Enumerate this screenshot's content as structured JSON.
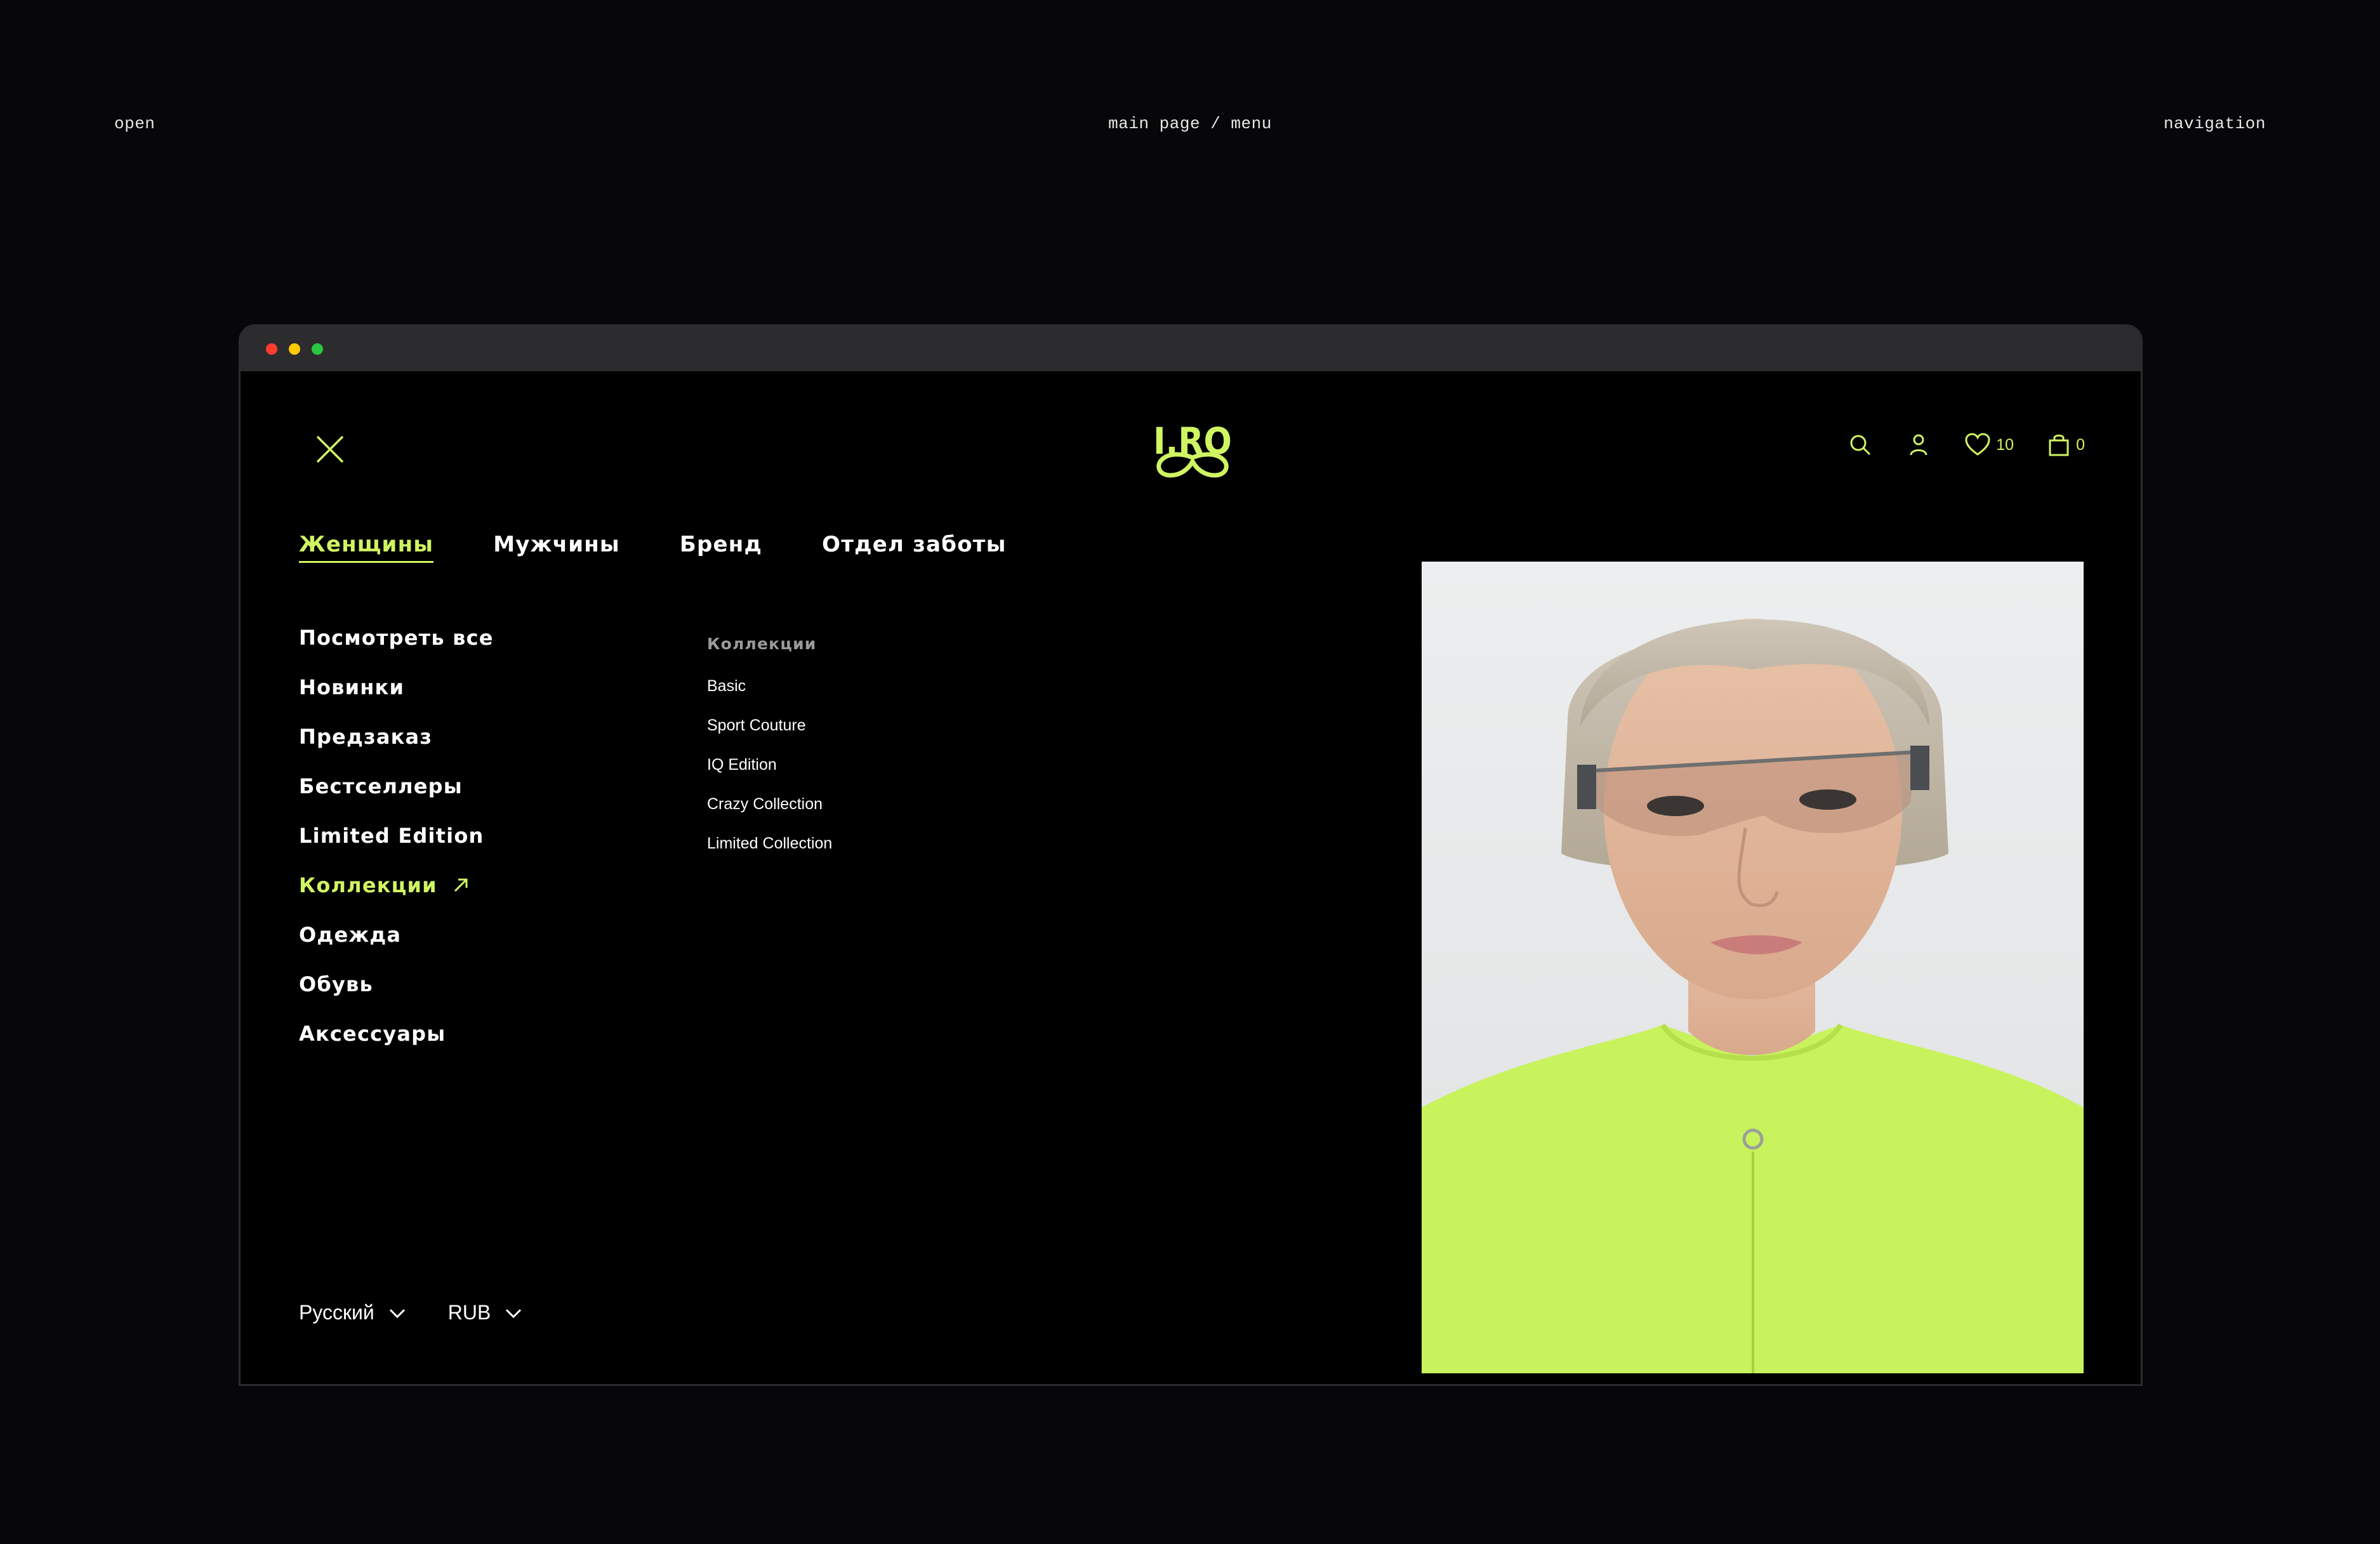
{
  "captions": {
    "left": "open",
    "center": "main page / menu",
    "right": "navigation"
  },
  "colors": {
    "accent": "#cff562",
    "background": "#000000",
    "window_chrome": "#2c2c2f"
  },
  "header": {
    "logo_text": "I.RO",
    "wishlist_count": "10",
    "cart_count": "0",
    "icons": [
      "close-icon",
      "search-icon",
      "user-icon",
      "heart-icon",
      "bag-icon"
    ]
  },
  "nav": {
    "tabs": [
      {
        "label": "Женщины",
        "active": true
      },
      {
        "label": "Мужчины"
      },
      {
        "label": "Бренд"
      },
      {
        "label": "Отдел заботы"
      }
    ]
  },
  "menu": {
    "categories": [
      {
        "label": "Посмотреть все"
      },
      {
        "label": "Новинки"
      },
      {
        "label": "Предзаказ"
      },
      {
        "label": "Бестселлеры"
      },
      {
        "label": "Limited Edition"
      },
      {
        "label": "Коллекции",
        "active": true
      },
      {
        "label": "Одежда"
      },
      {
        "label": "Обувь"
      },
      {
        "label": "Аксессуары"
      }
    ],
    "submenu": {
      "title": "Коллекции",
      "items": [
        "Basic",
        "Sport Couture",
        "IQ Edition",
        "Crazy Collection",
        "Limited Collection"
      ]
    }
  },
  "footer": {
    "language": "Русский",
    "currency": "RUB"
  }
}
